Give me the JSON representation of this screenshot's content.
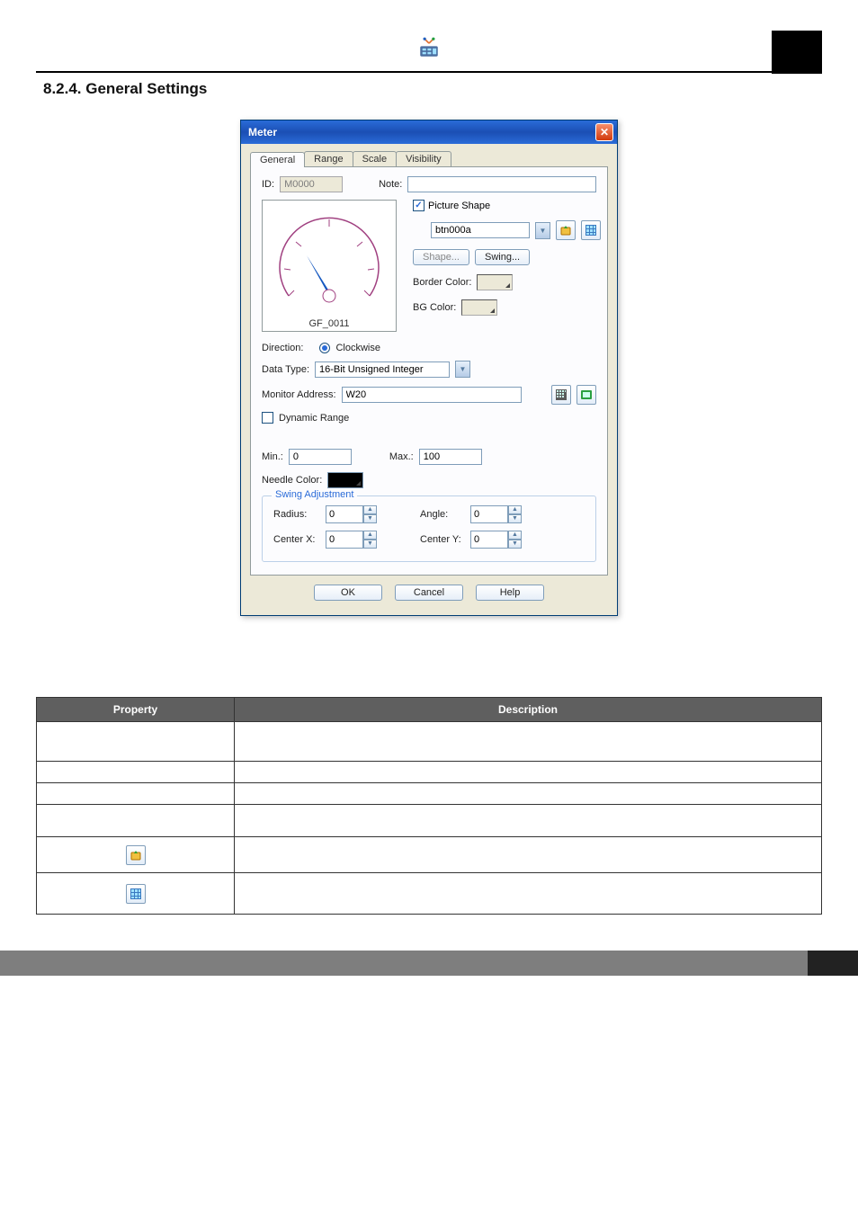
{
  "sectionTitle": "8.2.4. General Settings",
  "dialog": {
    "title": "Meter",
    "tabs": [
      "General",
      "Range",
      "Scale",
      "Visibility"
    ],
    "activeTab": "General",
    "idLabel": "ID:",
    "idValue": "M0000",
    "noteLabel": "Note:",
    "noteValue": "",
    "previewCaption": "GF_0011",
    "pictureShapeLabel": "Picture Shape",
    "pictureShapeChecked": true,
    "shapeSelectValue": "btn000a",
    "shapeBtn": "Shape...",
    "swingBtn": "Swing...",
    "borderColorLabel": "Border Color:",
    "bgColorLabel": "BG Color:",
    "directionLabel": "Direction:",
    "directionValue": "Clockwise",
    "dataTypeLabel": "Data Type:",
    "dataTypeValue": "16-Bit Unsigned Integer",
    "monitorAddrLabel": "Monitor Address:",
    "monitorAddrValue": "W20",
    "dynamicRangeLabel": "Dynamic Range",
    "dynamicRangeChecked": false,
    "minLabel": "Min.:",
    "minValue": "0",
    "maxLabel": "Max.:",
    "maxValue": "100",
    "needleColorLabel": "Needle Color:",
    "swingGroup": "Swing Adjustment",
    "radiusLabel": "Radius:",
    "radiusValue": "0",
    "angleLabel": "Angle:",
    "angleValue": "0",
    "centerXLabel": "Center X:",
    "centerXValue": "0",
    "centerYLabel": "Center Y:",
    "centerYValue": "0",
    "okBtn": "OK",
    "cancelBtn": "Cancel",
    "helpBtn": "Help"
  },
  "table": {
    "headers": {
      "property": "Property",
      "description": "Description"
    }
  }
}
